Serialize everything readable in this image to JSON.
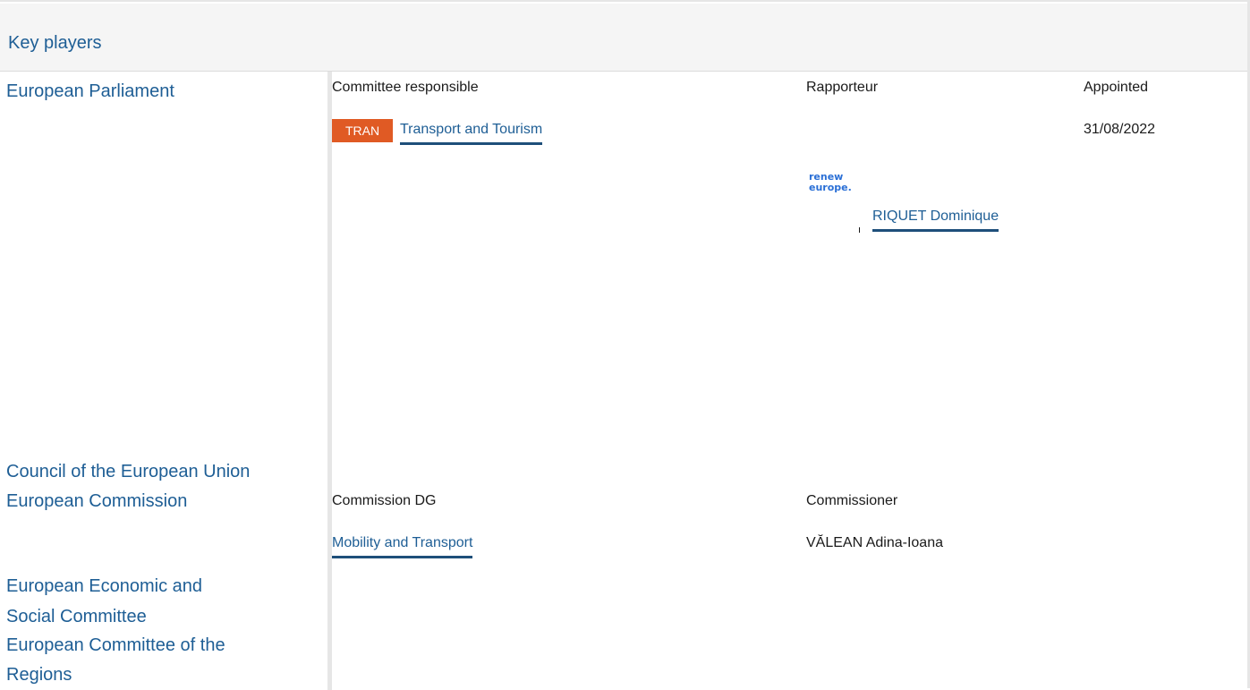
{
  "header": {
    "title": "Key players"
  },
  "players": {
    "ep": "European Parliament",
    "council": "Council of the European Union",
    "commission": "European Commission",
    "eesc_line1": "European Economic and",
    "eesc_line2": "Social Committee",
    "cor_line1": "European Committee of the",
    "cor_line2": "Regions"
  },
  "ep_section": {
    "committee_header": "Committee responsible",
    "rapporteur_header": "Rapporteur",
    "appointed_header": "Appointed",
    "committee_tag": "TRAN",
    "committee_name": "Transport and Tourism",
    "appointed_date": "31/08/2022",
    "group_logo_text_line1": "renew",
    "group_logo_text_line2": "europe.",
    "rapporteur_name": "RIQUET Dominique"
  },
  "commission_section": {
    "dg_header": "Commission DG",
    "commissioner_header": "Commissioner",
    "dg_name": "Mobility and Transport",
    "commissioner_name": "VĂLEAN Adina-Ioana"
  },
  "colors": {
    "link": "#1e5e95",
    "underline": "#1e4f7a",
    "tag": "#e05a24",
    "header_bg": "#f5f5f5"
  }
}
